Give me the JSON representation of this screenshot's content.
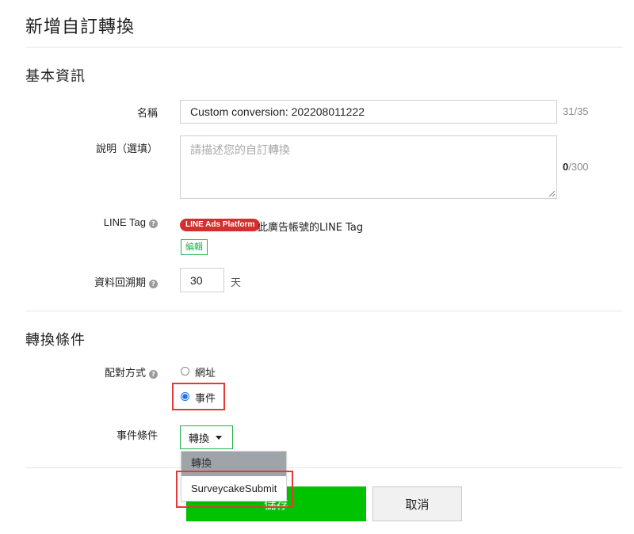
{
  "page": {
    "title": "新增自訂轉換"
  },
  "basic": {
    "section_title": "基本資訊",
    "name": {
      "label": "名稱",
      "value": "Custom conversion: 202208011222",
      "counter": "31/35"
    },
    "description": {
      "label": "說明（選填）",
      "placeholder": "請描述您的自訂轉換",
      "counter_current": "0",
      "counter_max": "/300"
    },
    "line_tag": {
      "label": "LINE Tag",
      "badge": "LINE Ads Platform",
      "text": "此廣告帳號的LINE Tag",
      "edit_label": "編輯"
    },
    "lookback": {
      "label": "資料回溯期",
      "value": "30",
      "unit": "天"
    }
  },
  "conditions": {
    "section_title": "轉換條件",
    "match": {
      "label": "配對方式",
      "options": [
        {
          "label": "網址",
          "checked": false
        },
        {
          "label": "事件",
          "checked": true
        }
      ]
    },
    "event": {
      "label": "事件條件",
      "selected": "轉換",
      "menu_items": [
        "轉換",
        "SurveycakeSubmit"
      ]
    }
  },
  "footer": {
    "save_label": "儲存",
    "cancel_label": "取消"
  },
  "colors": {
    "accent_green": "#00c300",
    "outline_green": "#22b14c",
    "highlight_red": "#e53935",
    "badge_red": "#d32f2f",
    "radio_blue": "#1a73e8"
  },
  "icons": [
    "help-icon",
    "chevron-down-icon",
    "resize-grip-icon"
  ]
}
